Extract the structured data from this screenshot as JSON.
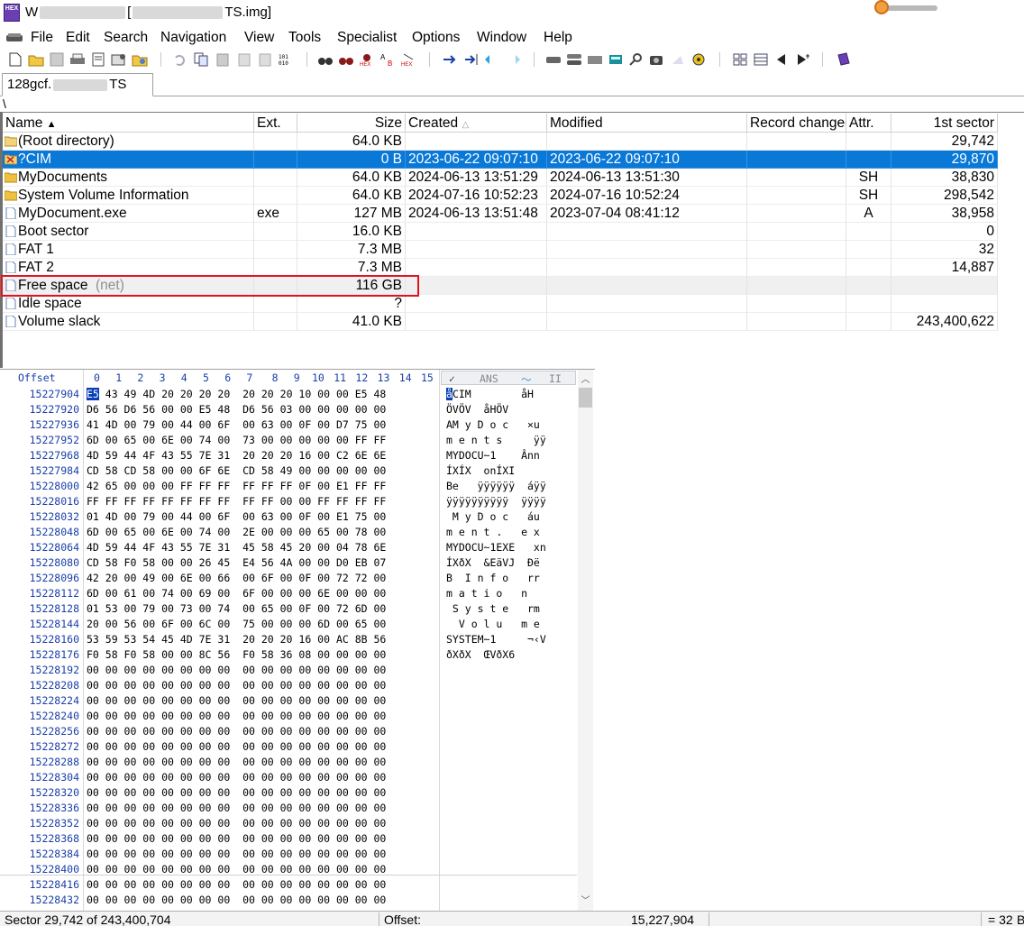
{
  "window": {
    "title_start": "W",
    "title_end": "TS.img]",
    "app_icon_text": "HEX"
  },
  "menu": [
    "File",
    "Edit",
    "Search",
    "Navigation",
    "View",
    "Tools",
    "Specialist",
    "Options",
    "Window",
    "Help"
  ],
  "toolbar_icons": [
    "new-file-icon",
    "open-file-icon",
    "save-icon",
    "print-icon",
    "properties-icon",
    "open-disk-icon",
    "undo-icon",
    "copy-icon",
    "paste-icon",
    "clipboard-icon",
    "paste-special-icon",
    "convert-icon",
    "find-icon",
    "find-text-icon",
    "find-hex-icon",
    "replace-text-icon",
    "replace-hex-icon",
    "goto-offset-icon",
    "goto-sector-icon",
    "back-icon",
    "forward-icon",
    "open-disk-2-icon",
    "disk-icon",
    "snapshot-icon",
    "calculator-icon",
    "magnifier-icon",
    "camera-icon",
    "cloud-icon",
    "gear-icon",
    "grid-icon",
    "table-icon",
    "previous-icon",
    "next-icon",
    "book-icon"
  ],
  "tab": {
    "label_start": "128gcf.",
    "label_end": "TS"
  },
  "path": "\\",
  "columns": {
    "name": "Name",
    "ext": "Ext.",
    "size": "Size",
    "created": "Created",
    "modified": "Modified",
    "record_changed": "Record changed",
    "attr": "Attr.",
    "first_sector": "1st sector"
  },
  "rows": [
    {
      "name": "(Root directory)",
      "ext": "",
      "size": "64.0 KB",
      "created": "",
      "modified": "",
      "attr": "",
      "sector": "29,742",
      "icon": "folder-open-icon"
    },
    {
      "name": "?CIM",
      "ext": "",
      "size": "0 B",
      "created": "2023-06-22  09:07:10",
      "modified": "2023-06-22  09:07:10",
      "attr": "",
      "sector": "29,870",
      "icon": "deleted-folder-icon"
    },
    {
      "name": "MyDocuments",
      "ext": "",
      "size": "64.0 KB",
      "created": "2024-06-13  13:51:29",
      "modified": "2024-06-13  13:51:30",
      "attr": "SH",
      "sector": "38,830",
      "icon": "folder-icon"
    },
    {
      "name": "System Volume Information",
      "ext": "",
      "size": "64.0 KB",
      "created": "2024-07-16  10:52:23",
      "modified": "2024-07-16  10:52:24",
      "attr": "SH",
      "sector": "298,542",
      "icon": "folder-icon"
    },
    {
      "name": "MyDocument.exe",
      "ext": "exe",
      "size": "127 MB",
      "created": "2024-06-13  13:51:48",
      "modified": "2023-07-04  08:41:12",
      "attr": "A",
      "sector": "38,958",
      "icon": "file-icon"
    },
    {
      "name": "Boot sector",
      "ext": "",
      "size": "16.0 KB",
      "created": "",
      "modified": "",
      "attr": "",
      "sector": "0",
      "icon": "file-icon"
    },
    {
      "name": "FAT 1",
      "ext": "",
      "size": "7.3 MB",
      "created": "",
      "modified": "",
      "attr": "",
      "sector": "32",
      "icon": "file-icon"
    },
    {
      "name": "FAT 2",
      "ext": "",
      "size": "7.3 MB",
      "created": "",
      "modified": "",
      "attr": "",
      "sector": "14,887",
      "icon": "file-icon"
    },
    {
      "name": "Free space",
      "suffix": "(net)",
      "ext": "",
      "size": "116 GB",
      "created": "",
      "modified": "",
      "attr": "",
      "sector": "",
      "icon": "file-icon"
    },
    {
      "name": "Idle space",
      "ext": "",
      "size": "?",
      "created": "",
      "modified": "",
      "attr": "",
      "sector": "",
      "icon": "file-icon"
    },
    {
      "name": "Volume slack",
      "ext": "",
      "size": "41.0 KB",
      "created": "",
      "modified": "",
      "attr": "",
      "sector": "243,400,622",
      "icon": "file-icon"
    }
  ],
  "hex": {
    "offset_label": "Offset",
    "columns": [
      "0",
      "1",
      "2",
      "3",
      "4",
      "5",
      "6",
      "7",
      "8",
      "9",
      "10",
      "11",
      "12",
      "13",
      "14",
      "15"
    ],
    "ascii_label_1": "ANS",
    "ascii_label_2": "II",
    "rows": [
      {
        "off": "15227904",
        "bytes": "E5 43 49 4D 20 20 20 20  20 20 20 10 00 00 E5 48",
        "ascii": "åCIM        åH"
      },
      {
        "off": "15227920",
        "bytes": "D6 56 D6 56 00 00 E5 48  D6 56 03 00 00 00 00 00",
        "ascii": "ÖVÖV  åHÖV"
      },
      {
        "off": "15227936",
        "bytes": "41 4D 00 79 00 44 00 6F  00 63 00 0F 00 D7 75 00",
        "ascii": "AM y D o c   ×u"
      },
      {
        "off": "15227952",
        "bytes": "6D 00 65 00 6E 00 74 00  73 00 00 00 00 00 FF FF",
        "ascii": "m e n t s     ÿÿ"
      },
      {
        "off": "15227968",
        "bytes": "4D 59 44 4F 43 55 7E 31  20 20 20 16 00 C2 6E 6E",
        "ascii": "MYDOCU~1    Ânn"
      },
      {
        "off": "15227984",
        "bytes": "CD 58 CD 58 00 00 6F 6E  CD 58 49 00 00 00 00 00",
        "ascii": "ÍXÍX  onÍXI"
      },
      {
        "off": "15228000",
        "bytes": "42 65 00 00 00 FF FF FF  FF FF FF 0F 00 E1 FF FF",
        "ascii": "Be   ÿÿÿÿÿÿ  áÿÿ"
      },
      {
        "off": "15228016",
        "bytes": "FF FF FF FF FF FF FF FF  FF FF 00 00 FF FF FF FF",
        "ascii": "ÿÿÿÿÿÿÿÿÿÿ  ÿÿÿÿ"
      },
      {
        "off": "15228032",
        "bytes": "01 4D 00 79 00 44 00 6F  00 63 00 0F 00 E1 75 00",
        "ascii": " M y D o c   áu"
      },
      {
        "off": "15228048",
        "bytes": "6D 00 65 00 6E 00 74 00  2E 00 00 00 65 00 78 00",
        "ascii": "m e n t .   e x"
      },
      {
        "off": "15228064",
        "bytes": "4D 59 44 4F 43 55 7E 31  45 58 45 20 00 04 78 6E",
        "ascii": "MYDOCU~1EXE   xn"
      },
      {
        "off": "15228080",
        "bytes": "CD 58 F0 58 00 00 26 45  E4 56 4A 00 00 D0 EB 07",
        "ascii": "ÍXðX  &EäVJ  Ðë"
      },
      {
        "off": "15228096",
        "bytes": "42 20 00 49 00 6E 00 66  00 6F 00 0F 00 72 72 00",
        "ascii": "B  I n f o   rr"
      },
      {
        "off": "15228112",
        "bytes": "6D 00 61 00 74 00 69 00  6F 00 00 00 6E 00 00 00",
        "ascii": "m a t i o   n"
      },
      {
        "off": "15228128",
        "bytes": "01 53 00 79 00 73 00 74  00 65 00 0F 00 72 6D 00",
        "ascii": " S y s t e   rm"
      },
      {
        "off": "15228144",
        "bytes": "20 00 56 00 6F 00 6C 00  75 00 00 00 6D 00 65 00",
        "ascii": "  V o l u   m e"
      },
      {
        "off": "15228160",
        "bytes": "53 59 53 54 45 4D 7E 31  20 20 20 16 00 AC 8B 56",
        "ascii": "SYSTEM~1     ¬‹V"
      },
      {
        "off": "15228176",
        "bytes": "F0 58 F0 58 00 00 8C 56  F0 58 36 08 00 00 00 00",
        "ascii": "ðXðX  ŒVðX6"
      },
      {
        "off": "15228192",
        "bytes": "00 00 00 00 00 00 00 00  00 00 00 00 00 00 00 00",
        "ascii": ""
      },
      {
        "off": "15228208",
        "bytes": "00 00 00 00 00 00 00 00  00 00 00 00 00 00 00 00",
        "ascii": ""
      },
      {
        "off": "15228224",
        "bytes": "00 00 00 00 00 00 00 00  00 00 00 00 00 00 00 00",
        "ascii": ""
      },
      {
        "off": "15228240",
        "bytes": "00 00 00 00 00 00 00 00  00 00 00 00 00 00 00 00",
        "ascii": ""
      },
      {
        "off": "15228256",
        "bytes": "00 00 00 00 00 00 00 00  00 00 00 00 00 00 00 00",
        "ascii": ""
      },
      {
        "off": "15228272",
        "bytes": "00 00 00 00 00 00 00 00  00 00 00 00 00 00 00 00",
        "ascii": ""
      },
      {
        "off": "15228288",
        "bytes": "00 00 00 00 00 00 00 00  00 00 00 00 00 00 00 00",
        "ascii": ""
      },
      {
        "off": "15228304",
        "bytes": "00 00 00 00 00 00 00 00  00 00 00 00 00 00 00 00",
        "ascii": ""
      },
      {
        "off": "15228320",
        "bytes": "00 00 00 00 00 00 00 00  00 00 00 00 00 00 00 00",
        "ascii": ""
      },
      {
        "off": "15228336",
        "bytes": "00 00 00 00 00 00 00 00  00 00 00 00 00 00 00 00",
        "ascii": ""
      },
      {
        "off": "15228352",
        "bytes": "00 00 00 00 00 00 00 00  00 00 00 00 00 00 00 00",
        "ascii": ""
      },
      {
        "off": "15228368",
        "bytes": "00 00 00 00 00 00 00 00  00 00 00 00 00 00 00 00",
        "ascii": ""
      },
      {
        "off": "15228384",
        "bytes": "00 00 00 00 00 00 00 00  00 00 00 00 00 00 00 00",
        "ascii": ""
      },
      {
        "off": "15228400",
        "bytes": "00 00 00 00 00 00 00 00  00 00 00 00 00 00 00 00",
        "ascii": ""
      },
      {
        "off": "15228416",
        "bytes": "00 00 00 00 00 00 00 00  00 00 00 00 00 00 00 00",
        "ascii": ""
      },
      {
        "off": "15228432",
        "bytes": "00 00 00 00 00 00 00 00  00 00 00 00 00 00 00 00",
        "ascii": ""
      }
    ]
  },
  "status": {
    "sector": "Sector 29,742 of 243,400,704",
    "offset_label": "Offset:",
    "offset_value": "15,227,904",
    "value": "= 32",
    "trailing": "B"
  },
  "colors": {
    "selection": "#0a78d7",
    "highlight_box": "#e0141e",
    "offset_text": "#1a3fa8"
  }
}
